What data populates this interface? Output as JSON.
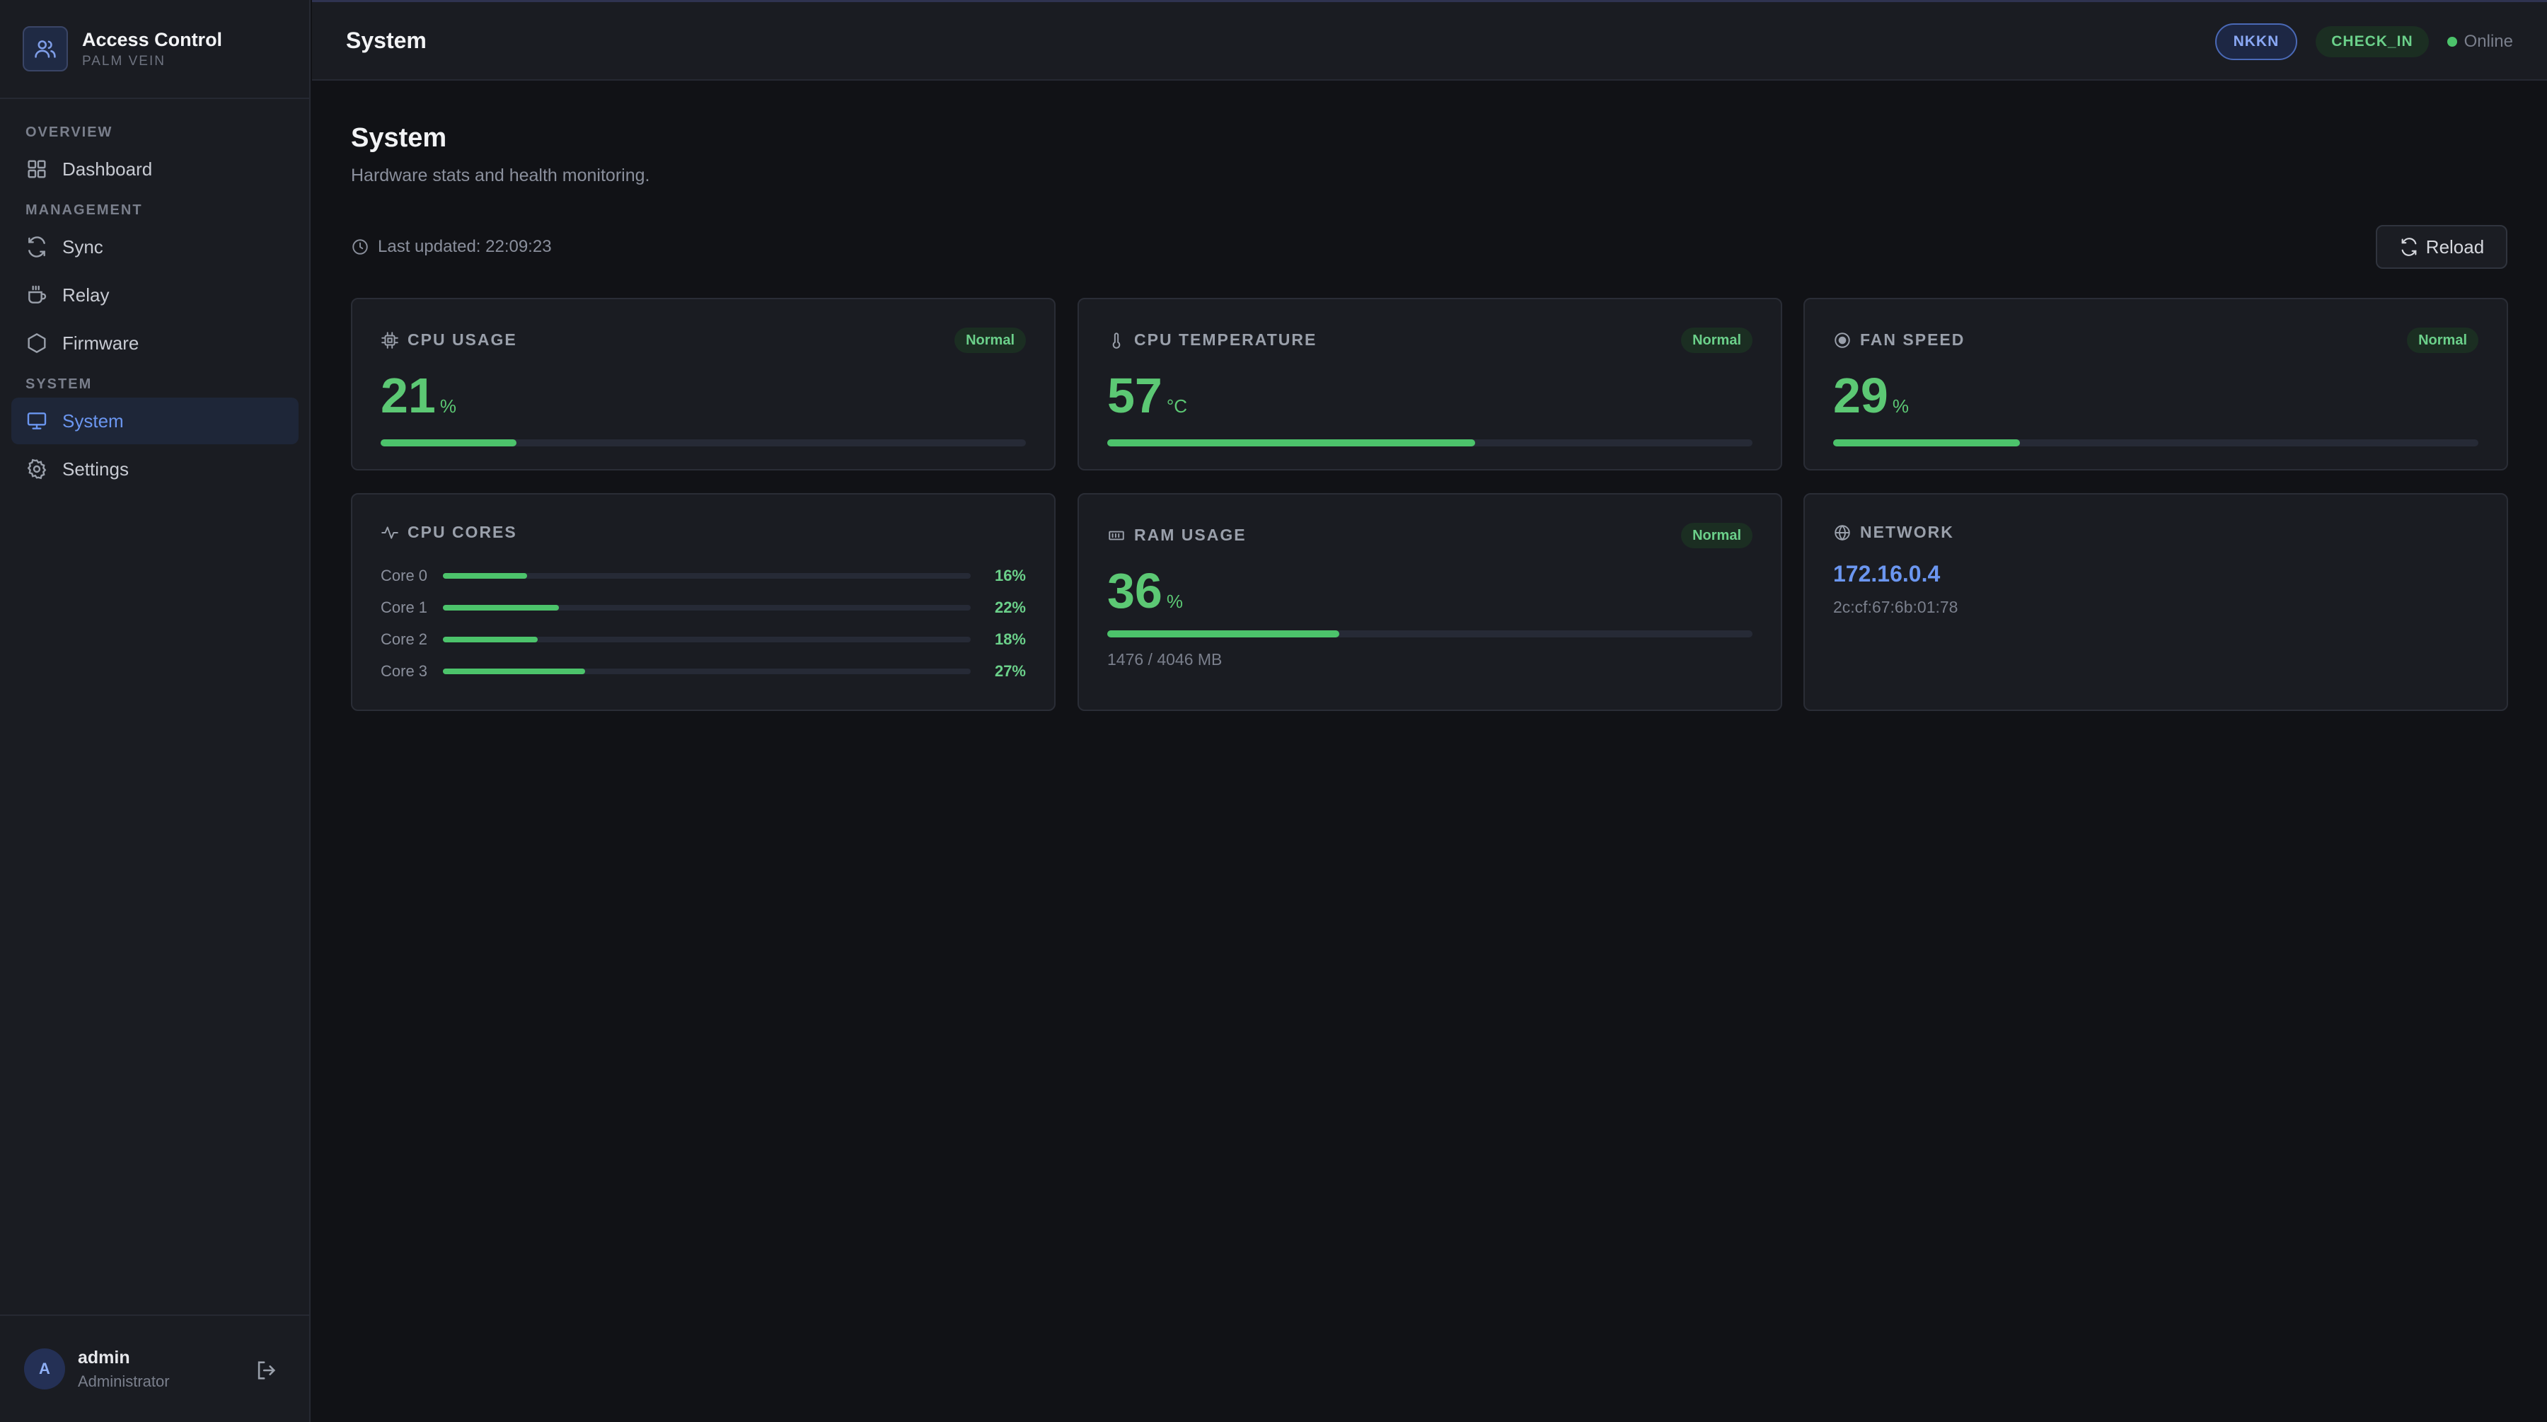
{
  "sidebar": {
    "brand_title": "Access Control",
    "brand_subtitle": "PALM VEIN",
    "sections": {
      "overview": "OVERVIEW",
      "management": "MANAGEMENT",
      "system": "SYSTEM"
    },
    "items": [
      {
        "label": "Dashboard",
        "icon": "grid-icon"
      },
      {
        "label": "Sync",
        "icon": "sync-icon"
      },
      {
        "label": "Relay",
        "icon": "relay-icon"
      },
      {
        "label": "Firmware",
        "icon": "hexagon-icon"
      },
      {
        "label": "System",
        "icon": "monitor-icon",
        "active": true
      },
      {
        "label": "Settings",
        "icon": "gear-icon"
      }
    ],
    "user": {
      "avatar": "A",
      "name": "admin",
      "role": "Administrator"
    }
  },
  "topbar": {
    "title": "System",
    "badge_device": "NKKN",
    "badge_mode": "CHECK_IN",
    "status": "Online"
  },
  "page": {
    "title": "System",
    "subtitle": "Hardware stats and health monitoring.",
    "last_updated": "Last updated: 22:09:23",
    "reload_label": "Reload"
  },
  "cards": {
    "cpu_usage": {
      "title": "CPU USAGE",
      "badge": "Normal",
      "value": "21",
      "unit": "%",
      "percent": 21
    },
    "cpu_temp": {
      "title": "CPU TEMPERATURE",
      "badge": "Normal",
      "value": "57",
      "unit": "°C",
      "percent": 57
    },
    "fan_speed": {
      "title": "FAN SPEED",
      "badge": "Normal",
      "value": "29",
      "unit": "%",
      "percent": 29
    },
    "cpu_cores": {
      "title": "CPU CORES",
      "cores": [
        {
          "label": "Core 0",
          "value": "16%",
          "percent": 16
        },
        {
          "label": "Core 1",
          "value": "22%",
          "percent": 22
        },
        {
          "label": "Core 2",
          "value": "18%",
          "percent": 18
        },
        {
          "label": "Core 3",
          "value": "27%",
          "percent": 27
        }
      ]
    },
    "ram_usage": {
      "title": "RAM USAGE",
      "badge": "Normal",
      "value": "36",
      "unit": "%",
      "percent": 36,
      "detail": "1476 / 4046 MB"
    },
    "network": {
      "title": "NETWORK",
      "ip": "172.16.0.4",
      "mac": "2c:cf:67:6b:01:78"
    }
  },
  "colors": {
    "accent_green": "#4cc36b",
    "accent_blue": "#6b96f0",
    "background": "#111216"
  }
}
